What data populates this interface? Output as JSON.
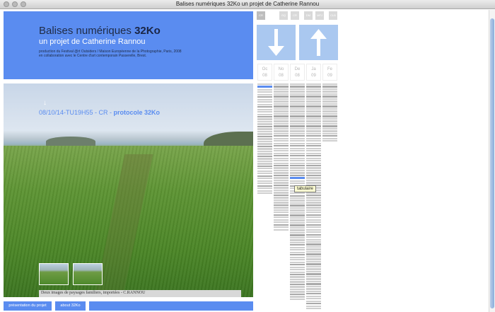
{
  "window": {
    "title": "Balises numériques 32Ko un projet de Catherine Rannou"
  },
  "header": {
    "title_plain": "Balises numériques",
    "title_bold": "32Ko",
    "subtitle": "un projet de Catherine Rannou",
    "credits_line1": "production du Festival @rt Outsiders / Maison Européenne de la Photographie, Paris, 2008",
    "credits_line2": "en collaboration avec le Centre d'art contemporain Passerelle, Brest."
  },
  "photo": {
    "arrow": "↓",
    "stamp_prefix": "08/10/14-TU19H55 - CR - ",
    "stamp_protocol": "protocole 32Ko",
    "caption": "Deux images de paysages familiers, importées - C.RANNOU"
  },
  "footer": {
    "presentation_label": "présentation du projet",
    "about_label": "about 32Ko",
    "extra_label": ""
  },
  "timeline": {
    "tabs": [
      "CR",
      "GQ",
      "CR",
      "DM",
      "MFJ",
      "CLB"
    ],
    "months": [
      {
        "name": "Oc",
        "year": "08"
      },
      {
        "name": "No",
        "year": "08"
      },
      {
        "name": "De",
        "year": "08"
      },
      {
        "name": "Ja",
        "year": "09"
      },
      {
        "name": "Fe",
        "year": "09"
      }
    ],
    "tooltip": "tabulaire"
  },
  "colors": {
    "accent": "#5a8cf0",
    "arrow_tile": "#aac8f0",
    "entry": "#cfcfcf"
  },
  "icons": {
    "up": "up-arrow-icon",
    "down": "down-arrow-icon"
  }
}
